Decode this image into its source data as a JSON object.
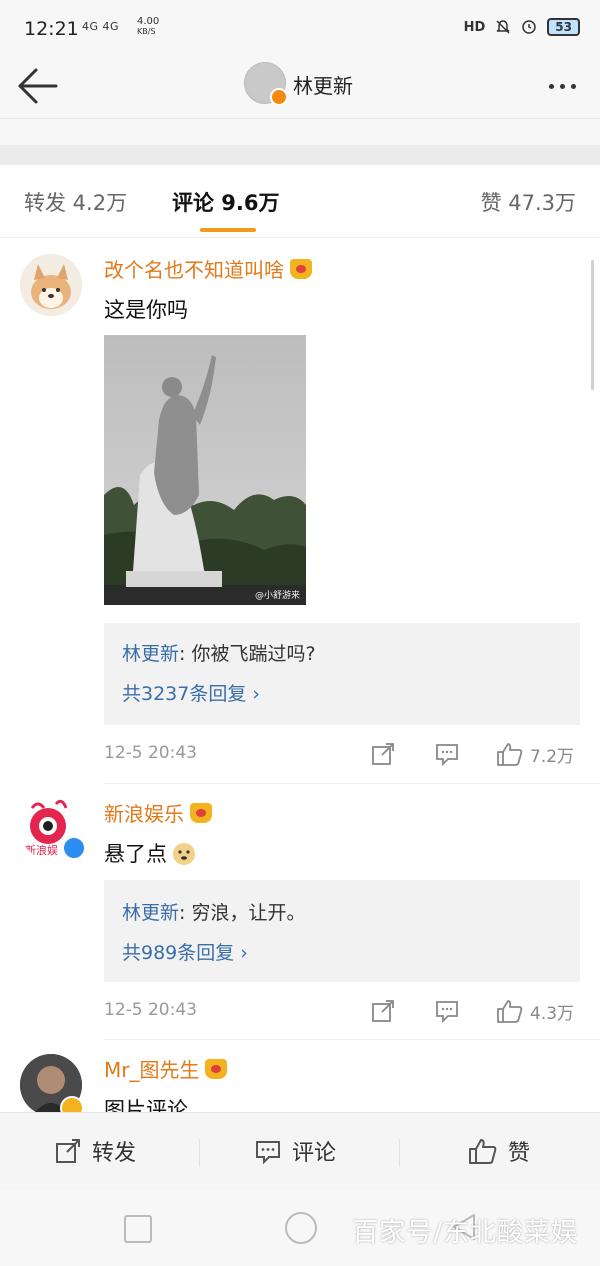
{
  "status_bar": {
    "time": "12:21",
    "network": "4G 4G",
    "speed_value": "4.00",
    "speed_unit": "KB/S",
    "hd_label": "HD",
    "battery": "53"
  },
  "nav": {
    "title": "林更新"
  },
  "tabs": {
    "repost": "转发 4.2万",
    "comment": "评论 9.6万",
    "like": "赞 47.3万"
  },
  "comments": [
    {
      "username": "改个名也不知道叫啥",
      "text": "这是你吗",
      "image_watermark": "@小舒游来",
      "reply": {
        "name": "林更新",
        "sep": ": ",
        "text": "你被飞踹过吗?",
        "count": "共3237条回复 ›"
      },
      "time": "12-5 20:43",
      "likes": "7.2万"
    },
    {
      "username": "新浪娱乐",
      "avatar_text": "新浪娱",
      "text": "悬了点",
      "reply": {
        "name": "林更新",
        "sep": ": ",
        "text": "穷浪，让开。",
        "count": "共989条回复 ›"
      },
      "time": "12-5 20:43",
      "likes": "4.3万"
    },
    {
      "username": "Mr_图先生",
      "text": "图片评论"
    }
  ],
  "bottom_bar": {
    "repost": "转发",
    "comment": "评论",
    "like": "赞"
  },
  "watermark": "百家号/东北酸菜娱"
}
